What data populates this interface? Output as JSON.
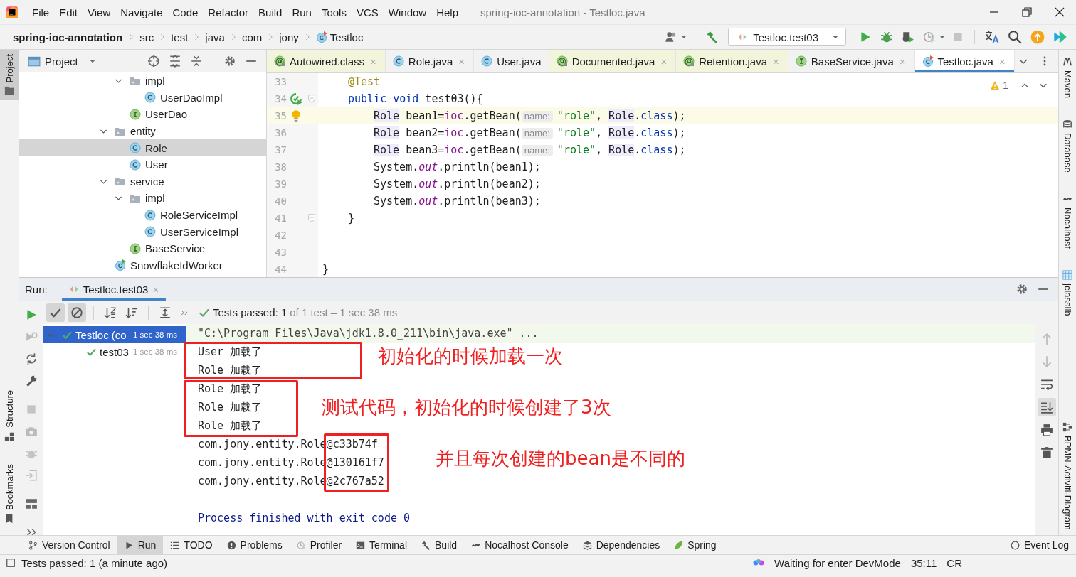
{
  "menu_bar": {
    "items": [
      "File",
      "Edit",
      "View",
      "Navigate",
      "Code",
      "Refactor",
      "Build",
      "Run",
      "Tools",
      "VCS",
      "Window",
      "Help"
    ],
    "title": "spring-ioc-annotation - Testloc.java"
  },
  "navigation_bar": {
    "breadcrumbs": [
      {
        "label": "spring-ioc-annotation",
        "kind": "project"
      },
      {
        "label": "src",
        "kind": "folder"
      },
      {
        "label": "test",
        "kind": "folder"
      },
      {
        "label": "java",
        "kind": "folder"
      },
      {
        "label": "com",
        "kind": "folder"
      },
      {
        "label": "jony",
        "kind": "folder"
      },
      {
        "label": "Testloc",
        "kind": "test-class"
      }
    ],
    "run_configuration": "Testloc.test03"
  },
  "left_stripe": {
    "top": [
      {
        "label": "Project",
        "selected": true
      }
    ],
    "bottom": [
      {
        "label": "Structure",
        "selected": false
      },
      {
        "label": "Bookmarks",
        "selected": false
      }
    ]
  },
  "project_panel": {
    "title": "Project",
    "tree": [
      {
        "children": [
          {
            "label": "impl",
            "kind": "folder",
            "expanded": true,
            "selected": false,
            "children": [
              {
                "label": "UserDaoImpl",
                "kind": "class",
                "selected": false
              }
            ]
          },
          {
            "label": "UserDao",
            "kind": "interface",
            "selected": false
          }
        ]
      },
      {
        "label": "entity",
        "kind": "folder",
        "expanded": true,
        "selected": false,
        "children": [
          {
            "label": "Role",
            "kind": "class",
            "selected": true
          },
          {
            "label": "User",
            "kind": "class",
            "selected": false
          }
        ]
      },
      {
        "label": "service",
        "kind": "folder",
        "expanded": true,
        "selected": false,
        "children": [
          {
            "label": "impl",
            "kind": "folder",
            "expanded": true,
            "selected": false,
            "children": [
              {
                "label": "RoleServiceImpl",
                "kind": "class",
                "selected": false
              },
              {
                "label": "UserServiceImpl",
                "kind": "class",
                "selected": false
              }
            ]
          },
          {
            "label": "BaseService",
            "kind": "interface",
            "selected": false
          }
        ]
      },
      {
        "label": "SnowflakeIdWorker",
        "kind": "runnable-class",
        "selected": false
      }
    ]
  },
  "editor": {
    "tabs": [
      {
        "label": "Autowired.class",
        "kind": "annotation",
        "non_project": true,
        "selected": false,
        "close": "×"
      },
      {
        "label": "Role.java",
        "kind": "class",
        "non_project": false,
        "selected": false,
        "close": "×"
      },
      {
        "label": "User.java",
        "kind": "class",
        "non_project": false,
        "selected": false
      },
      {
        "label": "Documented.java",
        "kind": "annotation",
        "non_project": true,
        "selected": false,
        "close": "×"
      },
      {
        "label": "Retention.java",
        "kind": "annotation",
        "non_project": true,
        "selected": false,
        "close": "×"
      },
      {
        "label": "BaseService.java",
        "kind": "interface",
        "non_project": false,
        "selected": false,
        "close": "×"
      },
      {
        "label": "Testloc.java",
        "kind": "test-class",
        "non_project": false,
        "selected": true,
        "close": "×"
      }
    ],
    "warnings": "1",
    "lines": [
      {
        "number": "33",
        "kind": "member",
        "current": false,
        "run_marker": false,
        "bulb": false,
        "segments": [
          {
            "kind": "annotation",
            "text": "@Test"
          }
        ]
      },
      {
        "number": "34",
        "kind": "member",
        "current": false,
        "run_marker": true,
        "bulb": false,
        "segments": [
          {
            "kind": "keyword",
            "text": "public void"
          },
          {
            "kind": "plain",
            "text": " test03(){"
          }
        ]
      },
      {
        "number": "35",
        "kind": "statement",
        "current": true,
        "run_marker": false,
        "bulb": true,
        "segments": [
          {
            "kind": "usage",
            "text": "Role"
          },
          {
            "kind": "plain",
            "text": " bean1="
          },
          {
            "kind": "field",
            "text": "ioc"
          },
          {
            "kind": "plain",
            "text": ".getBean("
          },
          {
            "kind": "hint",
            "text": "name:"
          },
          {
            "kind": "string",
            "text": "\"role\""
          },
          {
            "kind": "plain",
            "text": ", "
          },
          {
            "kind": "usage",
            "text": "Role"
          },
          {
            "kind": "plain",
            "text": "."
          },
          {
            "kind": "keyword",
            "text": "class"
          },
          {
            "kind": "plain",
            "text": ");"
          }
        ]
      },
      {
        "number": "36",
        "kind": "statement",
        "current": false,
        "run_marker": false,
        "bulb": false,
        "segments": [
          {
            "kind": "usage",
            "text": "Role"
          },
          {
            "kind": "plain",
            "text": " bean2="
          },
          {
            "kind": "field",
            "text": "ioc"
          },
          {
            "kind": "plain",
            "text": ".getBean("
          },
          {
            "kind": "hint",
            "text": "name:"
          },
          {
            "kind": "string",
            "text": "\"role\""
          },
          {
            "kind": "plain",
            "text": ", "
          },
          {
            "kind": "usage",
            "text": "Role"
          },
          {
            "kind": "plain",
            "text": "."
          },
          {
            "kind": "keyword",
            "text": "class"
          },
          {
            "kind": "plain",
            "text": ");"
          }
        ]
      },
      {
        "number": "37",
        "kind": "statement",
        "current": false,
        "run_marker": false,
        "bulb": false,
        "segments": [
          {
            "kind": "usage",
            "text": "Role"
          },
          {
            "kind": "plain",
            "text": " bean3="
          },
          {
            "kind": "field",
            "text": "ioc"
          },
          {
            "kind": "plain",
            "text": ".getBean("
          },
          {
            "kind": "hint",
            "text": "name:"
          },
          {
            "kind": "string",
            "text": "\"role\""
          },
          {
            "kind": "plain",
            "text": ", "
          },
          {
            "kind": "usage",
            "text": "Role"
          },
          {
            "kind": "plain",
            "text": "."
          },
          {
            "kind": "keyword",
            "text": "class"
          },
          {
            "kind": "plain",
            "text": ");"
          }
        ]
      },
      {
        "number": "38",
        "kind": "statement",
        "current": false,
        "run_marker": false,
        "bulb": false,
        "segments": [
          {
            "kind": "plain",
            "text": "System."
          },
          {
            "kind": "static",
            "text": "out"
          },
          {
            "kind": "plain",
            "text": ".println(bean1);"
          }
        ]
      },
      {
        "number": "39",
        "kind": "statement",
        "current": false,
        "run_marker": false,
        "bulb": false,
        "segments": [
          {
            "kind": "plain",
            "text": "System."
          },
          {
            "kind": "static",
            "text": "out"
          },
          {
            "kind": "plain",
            "text": ".println(bean2);"
          }
        ]
      },
      {
        "number": "40",
        "kind": "statement",
        "current": false,
        "run_marker": false,
        "bulb": false,
        "segments": [
          {
            "kind": "plain",
            "text": "System."
          },
          {
            "kind": "static",
            "text": "out"
          },
          {
            "kind": "plain",
            "text": ".println(bean3);"
          }
        ]
      },
      {
        "number": "41",
        "kind": "member",
        "current": false,
        "run_marker": false,
        "bulb": false,
        "segments": [
          {
            "kind": "plain",
            "text": "}"
          }
        ]
      },
      {
        "number": "42",
        "kind": "blank",
        "current": false,
        "run_marker": false,
        "bulb": false
      },
      {
        "number": "43",
        "kind": "blank",
        "current": false,
        "run_marker": false,
        "bulb": false
      },
      {
        "number": "44",
        "kind": "top",
        "current": false,
        "run_marker": false,
        "bulb": false,
        "segments": [
          {
            "kind": "plain",
            "text": "}"
          }
        ]
      }
    ]
  },
  "right_stripe": [
    {
      "label": "Maven",
      "kind": "maven"
    },
    {
      "label": "Database",
      "kind": "database"
    },
    {
      "label": "Nocalhost",
      "kind": "nocalhost"
    },
    {
      "label": "jclasslib",
      "kind": "jclasslib"
    },
    {
      "label": "BPMN-Activiti-Diagram",
      "kind": "bpmn"
    }
  ],
  "run_panel": {
    "label": "Run:",
    "tab": {
      "title": "Testloc.test03",
      "close": "×"
    },
    "toggles": [
      {
        "kind": "show-passed",
        "selected": true
      },
      {
        "kind": "show-ignored",
        "selected": true
      }
    ],
    "summary": "Tests passed: 1",
    "summary_detail": "of 1 test – 1 sec 38 ms",
    "tests": [
      {
        "name": "Testloc (co",
        "time": "1 sec 38 ms",
        "selected": true,
        "expanded": true,
        "children": [
          {
            "name": "test03",
            "time": "1 sec 38 ms",
            "selected": false
          }
        ]
      }
    ],
    "console": [
      {
        "kind": "command",
        "text": "\"C:\\Program Files\\Java\\jdk1.8.0_211\\bin\\java.exe\" ..."
      },
      {
        "kind": "output",
        "text": "User 加载了"
      },
      {
        "kind": "output",
        "text": "Role 加载了"
      },
      {
        "kind": "output",
        "text": "Role 加载了"
      },
      {
        "kind": "output",
        "text": "Role 加载了"
      },
      {
        "kind": "output",
        "text": "Role 加载了"
      },
      {
        "kind": "output",
        "text": "com.jony.entity.Role@c33b74f"
      },
      {
        "kind": "output",
        "text": "com.jony.entity.Role@130161f7"
      },
      {
        "kind": "output",
        "text": "com.jony.entity.Role@2c767a52"
      },
      {
        "kind": "blank"
      },
      {
        "kind": "exit",
        "text": "Process finished with exit code 0"
      }
    ],
    "console_tools": [
      {
        "kind": "up",
        "selected": false
      },
      {
        "kind": "down",
        "selected": false
      },
      {
        "kind": "wrap",
        "selected": false
      },
      {
        "kind": "scroll-end",
        "selected": true
      },
      {
        "kind": "print",
        "selected": false
      },
      {
        "kind": "trash",
        "selected": false
      }
    ],
    "annotations": [
      {
        "text": "初始化的时候加载一次"
      },
      {
        "text": "测试代码，初始化的时候创建了3次"
      },
      {
        "text": "并且每次创建的bean是不同的"
      }
    ]
  },
  "tool_window_bar": [
    {
      "label": "Version Control",
      "kind": "vcs",
      "selected": false
    },
    {
      "label": "Run",
      "kind": "run",
      "selected": true
    },
    {
      "label": "TODO",
      "kind": "todo",
      "selected": false
    },
    {
      "label": "Problems",
      "kind": "problems",
      "selected": false
    },
    {
      "label": "Profiler",
      "kind": "profiler",
      "selected": false
    },
    {
      "label": "Terminal",
      "kind": "terminal",
      "selected": false
    },
    {
      "label": "Build",
      "kind": "build",
      "selected": false
    },
    {
      "label": "Nocalhost Console",
      "kind": "nocalhost",
      "selected": false
    },
    {
      "label": "Dependencies",
      "kind": "dependencies",
      "selected": false
    },
    {
      "label": "Spring",
      "kind": "spring",
      "selected": false
    },
    {
      "label": "Event Log",
      "kind": "event-log",
      "selected": false
    }
  ],
  "status_bar": {
    "message": "Tests passed: 1 (a minute ago)",
    "devmode": "Waiting for enter DevMode",
    "position": "35:11",
    "line_separator": "CR"
  }
}
